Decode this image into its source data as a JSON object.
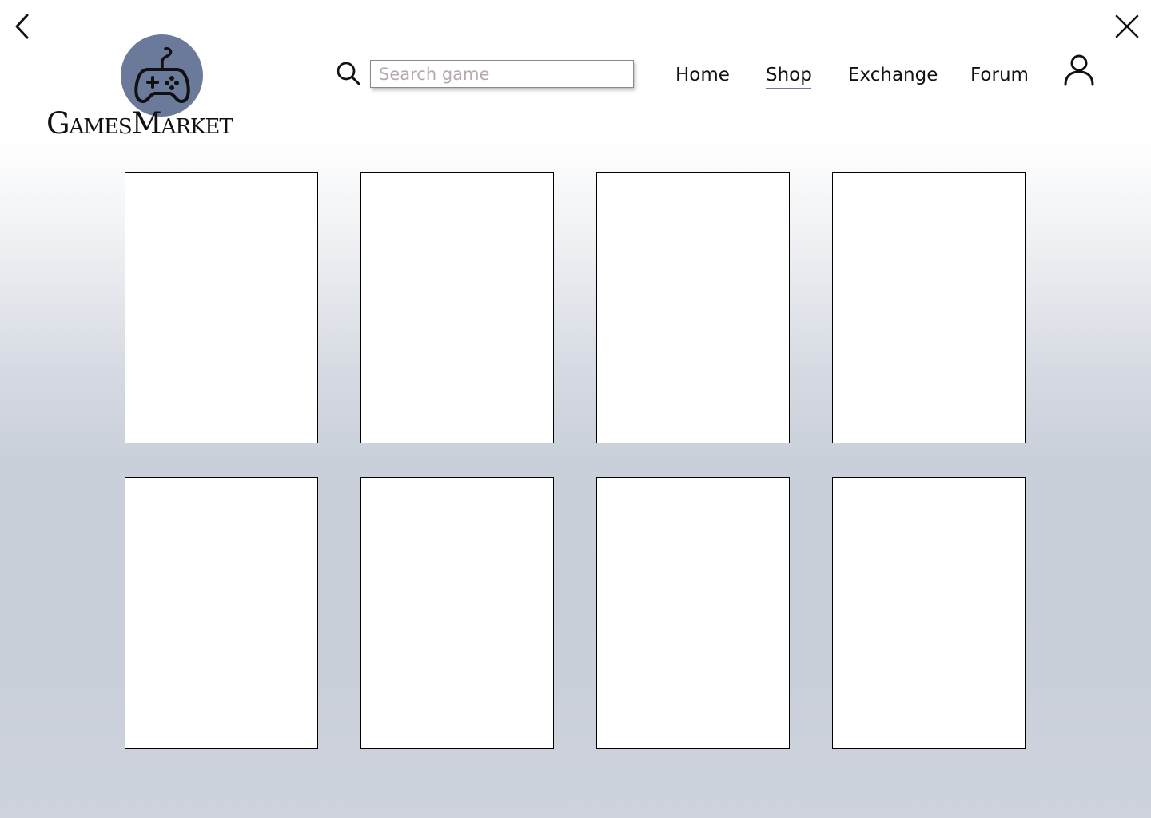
{
  "window": {
    "back_icon": "chevron-left-icon",
    "close_icon": "close-icon"
  },
  "brand": {
    "name": "GamesMarket",
    "logo_icon": "gamepad-icon",
    "logo_circle_color": "#6b7a9a"
  },
  "search": {
    "icon": "search-icon",
    "placeholder": "Search game",
    "value": ""
  },
  "nav": {
    "items": [
      {
        "label": "Home",
        "active": false
      },
      {
        "label": "Shop",
        "active": true
      },
      {
        "label": "Exchange",
        "active": false
      },
      {
        "label": "Forum",
        "active": false
      }
    ],
    "active_underline_color": "#6b7a9a"
  },
  "user": {
    "icon": "user-icon"
  },
  "grid": {
    "rows": 2,
    "columns": 4,
    "card_count": 8
  }
}
